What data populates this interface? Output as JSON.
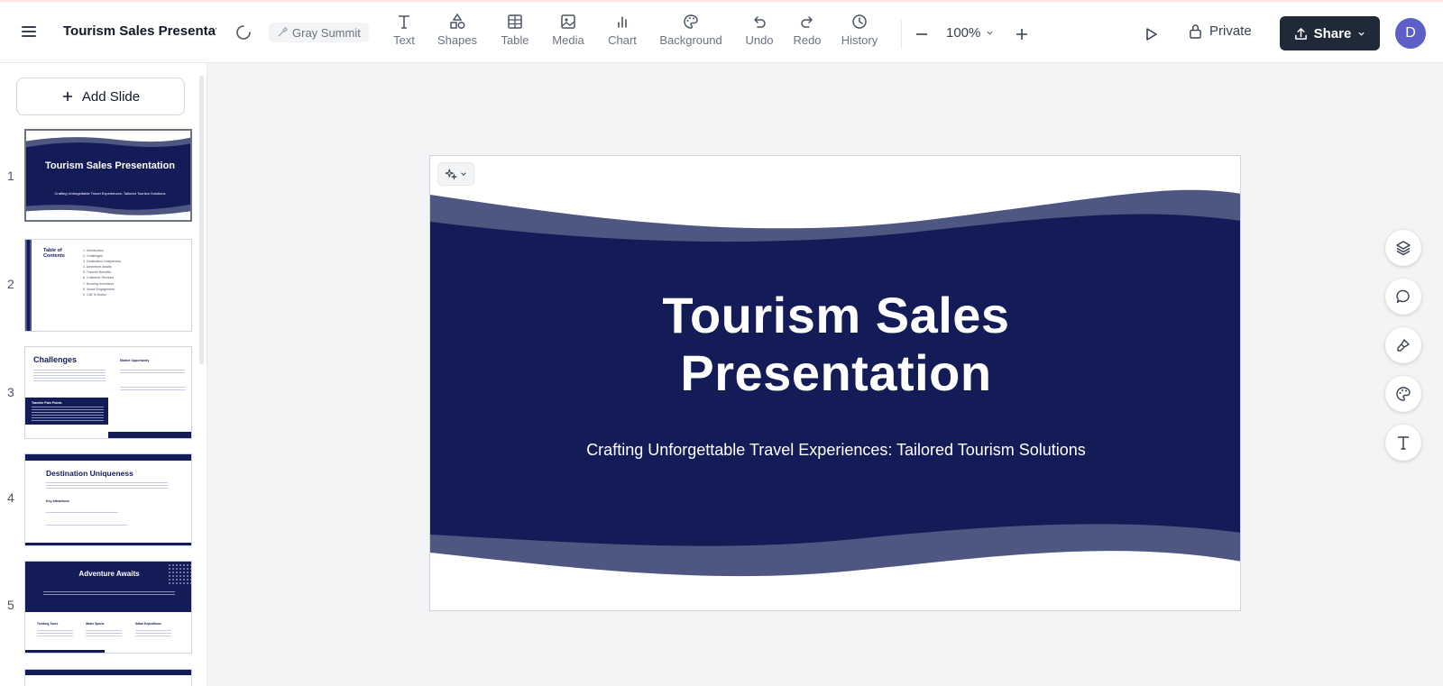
{
  "document": {
    "title": "Tourism Sales Presentati"
  },
  "toolbar": {
    "theme": "Gray Summit",
    "tools": [
      {
        "label": "Text",
        "icon": "text-icon"
      },
      {
        "label": "Shapes",
        "icon": "shapes-icon"
      },
      {
        "label": "Table",
        "icon": "table-icon"
      },
      {
        "label": "Media",
        "icon": "media-icon"
      },
      {
        "label": "Chart",
        "icon": "chart-icon"
      },
      {
        "label": "Background",
        "icon": "palette-icon"
      },
      {
        "label": "Undo",
        "icon": "undo-icon"
      },
      {
        "label": "Redo",
        "icon": "redo-icon"
      },
      {
        "label": "History",
        "icon": "history-icon"
      }
    ],
    "zoom": "100%",
    "visibility": "Private",
    "share_label": "Share",
    "avatar_initial": "D"
  },
  "sidebar": {
    "add_slide_label": "Add Slide",
    "slides": [
      {
        "number": "1",
        "title": "Tourism Sales Presentation",
        "subtitle": "Crafting Unforgettable Travel Experiences: Tailored Tourism Solutions"
      },
      {
        "number": "2",
        "title": "Table of Contents",
        "items": [
          "1. Introduction",
          "2. Challenges",
          "3. Destination Uniqueness",
          "4. Adventure Awaits",
          "5. Traveler Benefits",
          "6. Customer Reviews",
          "7. Booking Incentives",
          "8. Visual Engagement",
          "9. Call To Action"
        ]
      },
      {
        "number": "3",
        "title": "Challenges",
        "side_heading": "Market Opportunity",
        "box_heading": "Traveler Pain Points"
      },
      {
        "number": "4",
        "title": "Destination Uniqueness",
        "side_heading": "Key Attractions"
      },
      {
        "number": "5",
        "title": "Adventure Awaits",
        "columns": [
          "Trekking Tours",
          "Water Sports",
          "Safari Expeditions"
        ]
      }
    ]
  },
  "slide": {
    "title_line1": "Tourism Sales",
    "title_line2": "Presentation",
    "subtitle": "Crafting Unforgettable Travel Experiences: Tailored Tourism Solutions"
  },
  "colors": {
    "navy": "#131c56",
    "wave": "#4e5781",
    "accent_dark": "#1f2937",
    "avatar": "#5b5fc7"
  },
  "right_tools": [
    "layers-icon",
    "comment-icon",
    "brush-icon",
    "palette-icon",
    "text-icon"
  ]
}
